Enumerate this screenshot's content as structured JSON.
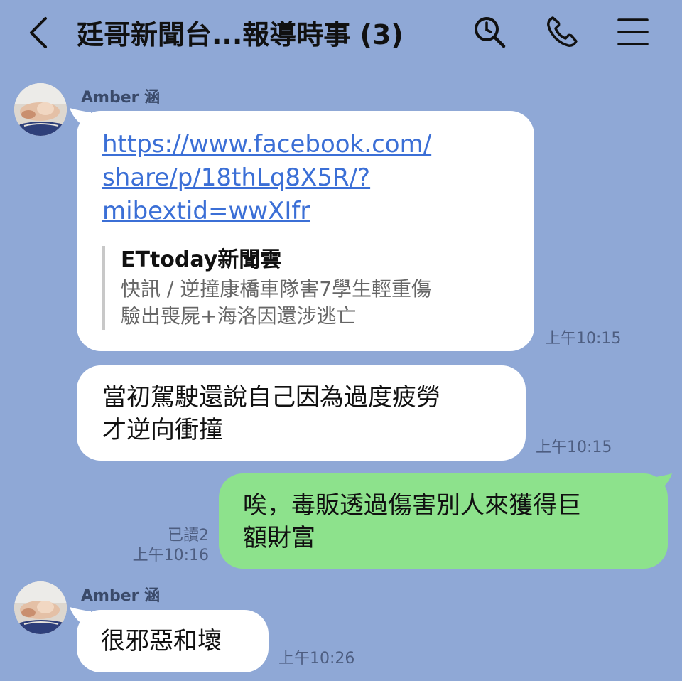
{
  "header": {
    "title": "廷哥新聞台...報導時事 (3)",
    "back_icon": "chevron-left-icon",
    "search_icon": "search-icon",
    "call_icon": "phone-icon",
    "menu_icon": "hamburger-menu-icon"
  },
  "messages": [
    {
      "sender": "Amber 涵",
      "type": "link",
      "link_text": "https://www.facebook.com/\nshare/p/18thLq8X5R/?\nmibextid=wwXIfr",
      "preview_source": "ETtoday新聞雲",
      "preview_desc": "快訊 / 逆撞康橋車隊害7學生輕重傷\n驗出喪屍+海洛因還涉逃亡",
      "time": "上午10:15"
    },
    {
      "type": "text",
      "text": "當初駕駛還說自己因為過度疲勞\n才逆向衝撞",
      "time": "上午10:15"
    },
    {
      "type": "sent",
      "text": "唉，毒販透過傷害別人來獲得巨\n額財富",
      "read": "已讀2",
      "time": "上午10:16"
    },
    {
      "sender": "Amber 涵",
      "type": "text",
      "text": "很邪惡和壞",
      "time": "上午10:26"
    }
  ],
  "colors": {
    "background": "#8fa8d6",
    "received_bubble": "#ffffff",
    "sent_bubble": "#8de28c",
    "link": "#3b6fd6"
  }
}
